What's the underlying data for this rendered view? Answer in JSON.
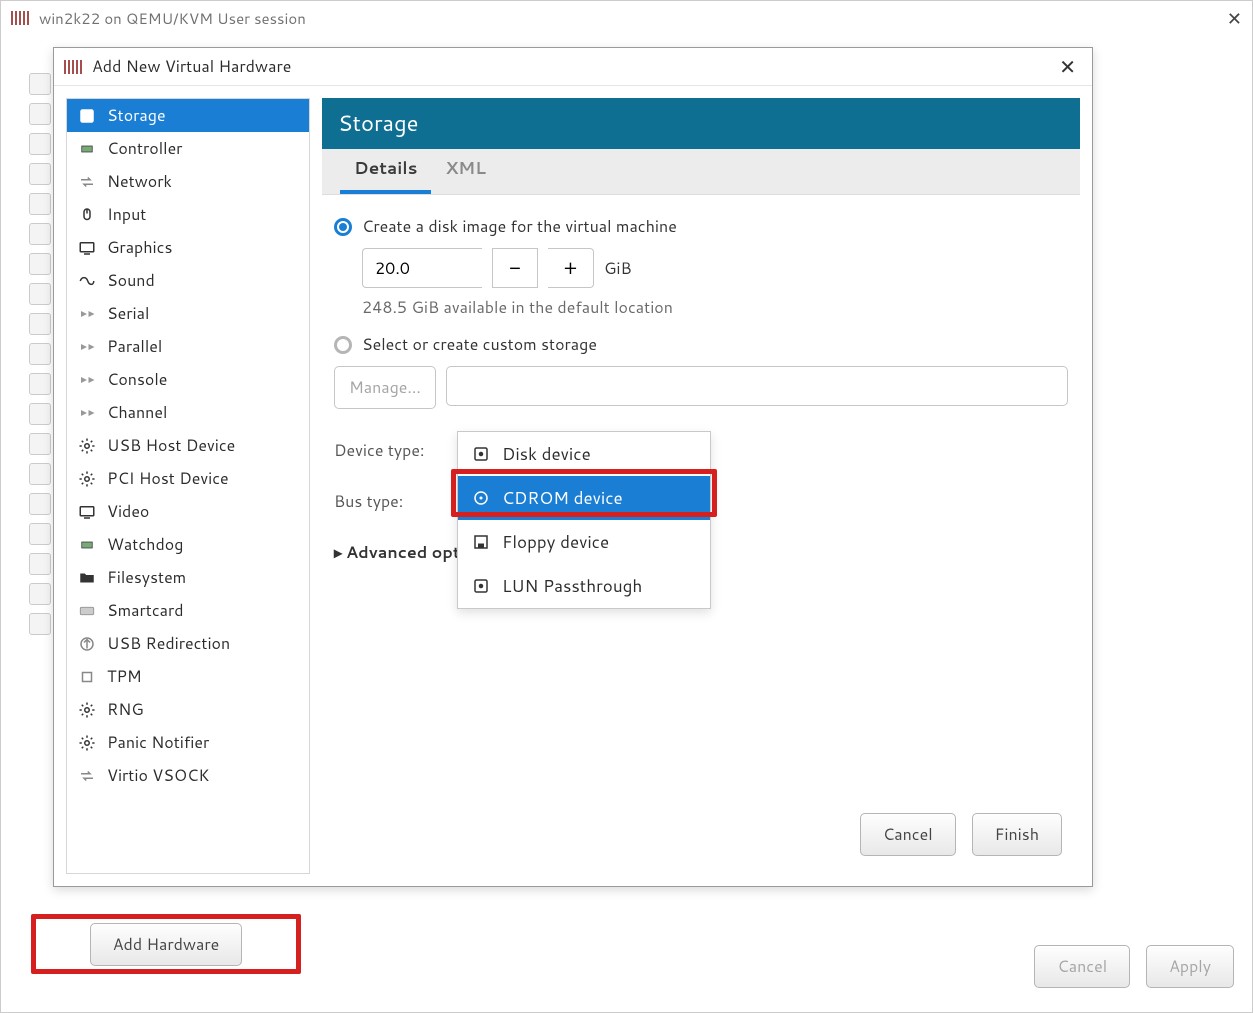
{
  "parent": {
    "title": "win2k22 on QEMU/KVM User session",
    "footer": {
      "add_hardware": "Add Hardware",
      "cancel": "Cancel",
      "apply": "Apply"
    }
  },
  "dialog": {
    "title": "Add New Virtual Hardware",
    "hw_list": [
      {
        "label": "Storage",
        "icon": "disk",
        "selected": true
      },
      {
        "label": "Controller",
        "icon": "chip"
      },
      {
        "label": "Network",
        "icon": "swap"
      },
      {
        "label": "Input",
        "icon": "mouse"
      },
      {
        "label": "Graphics",
        "icon": "monitor"
      },
      {
        "label": "Sound",
        "icon": "sound"
      },
      {
        "label": "Serial",
        "icon": "port"
      },
      {
        "label": "Parallel",
        "icon": "port"
      },
      {
        "label": "Console",
        "icon": "port"
      },
      {
        "label": "Channel",
        "icon": "port"
      },
      {
        "label": "USB Host Device",
        "icon": "gear"
      },
      {
        "label": "PCI Host Device",
        "icon": "gear"
      },
      {
        "label": "Video",
        "icon": "monitor"
      },
      {
        "label": "Watchdog",
        "icon": "chip"
      },
      {
        "label": "Filesystem",
        "icon": "folder"
      },
      {
        "label": "Smartcard",
        "icon": "card"
      },
      {
        "label": "USB Redirection",
        "icon": "usb"
      },
      {
        "label": "TPM",
        "icon": "cpu"
      },
      {
        "label": "RNG",
        "icon": "gear"
      },
      {
        "label": "Panic Notifier",
        "icon": "gear"
      },
      {
        "label": "Virtio VSOCK",
        "icon": "swap"
      }
    ],
    "pane_title": "Storage",
    "tabs": {
      "details": "Details",
      "xml": "XML"
    },
    "form": {
      "radio_create": "Create a disk image for the virtual machine",
      "disk_size": "20.0",
      "unit": "GiB",
      "available": "248.5 GiB available in the default location",
      "radio_select": "Select or create custom storage",
      "manage": "Manage...",
      "device_type_label": "Device type:",
      "bus_type_label": "Bus type:",
      "advanced": "Advanced options",
      "dropdown": [
        {
          "label": "Disk device",
          "icon": "disk"
        },
        {
          "label": "CDROM device",
          "icon": "cd",
          "selected": true
        },
        {
          "label": "Floppy device",
          "icon": "floppy"
        },
        {
          "label": "LUN Passthrough",
          "icon": "disk"
        }
      ]
    },
    "footer": {
      "cancel": "Cancel",
      "finish": "Finish"
    }
  }
}
